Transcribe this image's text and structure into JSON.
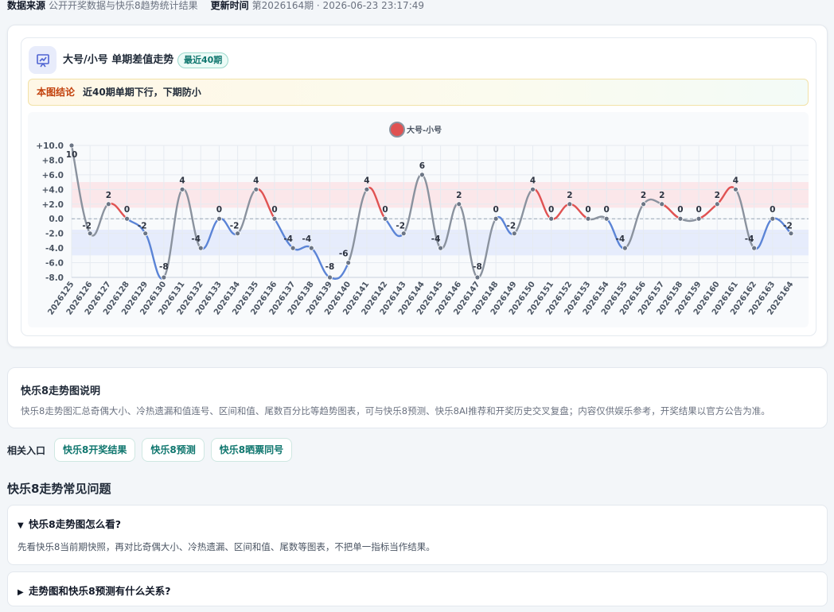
{
  "meta": {
    "source_label": "数据来源",
    "source_value": "公开开奖数据与快乐8趋势统计结果",
    "update_label": "更新时间",
    "update_value": "第2026164期 · 2026-06-23 23:17:49"
  },
  "card": {
    "icon": "presentation-chart-icon",
    "title": "大号/小号 单期差值走势",
    "badge": "最近40期",
    "conclusion_label": "本图结论",
    "conclusion_text": "近40期单期下行，下期防小"
  },
  "chart_data": {
    "type": "line",
    "legend": "大号-小号",
    "legend_position": "top-center",
    "x": [
      "2026125",
      "2026126",
      "2026127",
      "2026128",
      "2026129",
      "2026130",
      "2026131",
      "2026132",
      "2026133",
      "2026134",
      "2026135",
      "2026136",
      "2026137",
      "2026138",
      "2026139",
      "2026140",
      "2026141",
      "2026142",
      "2026143",
      "2026144",
      "2026145",
      "2026146",
      "2026147",
      "2026148",
      "2026149",
      "2026150",
      "2026151",
      "2026152",
      "2026153",
      "2026154",
      "2026155",
      "2026156",
      "2026157",
      "2026158",
      "2026159",
      "2026160",
      "2026161",
      "2026162",
      "2026163",
      "2026164"
    ],
    "series": [
      {
        "name": "大号-小号",
        "values": [
          10,
          -2,
          2,
          0,
          -2,
          -8,
          4,
          -4,
          0,
          -2,
          4,
          0,
          -4,
          -4,
          -8,
          -6,
          4,
          0,
          -2,
          6,
          -4,
          2,
          -8,
          0,
          -2,
          4,
          0,
          2,
          0,
          0,
          -4,
          2,
          2,
          0,
          0,
          2,
          4,
          -4,
          0,
          -2
        ]
      }
    ],
    "ylim": [
      -8,
      10
    ],
    "yticks": [
      "+10.0",
      "+8.0",
      "+6.0",
      "+4.0",
      "+2.0",
      "0.0",
      "-2.0",
      "-4.0",
      "-6.0",
      "-8.0"
    ],
    "bands": [
      {
        "from": 1.5,
        "to": 5
      },
      {
        "from": -5,
        "to": -1.5
      }
    ],
    "colors": {
      "up": "#e05252",
      "down": "#5b84d6",
      "flat": "#8a929e",
      "band_up": "#fbe3e6",
      "band_down": "#e3e9fb"
    },
    "grid": true
  },
  "explain": {
    "title": "快乐8走势图说明",
    "text": "快乐8走势图汇总奇偶大小、冷热遗漏和值连号、区间和值、尾数百分比等趋势图表，可与快乐8预测、快乐8AI推荐和开奖历史交叉复盘；内容仅供娱乐参考，开奖结果以官方公告为准。"
  },
  "related": {
    "label": "相关入口",
    "links": [
      "快乐8开奖结果",
      "快乐8预测",
      "快乐8晒票同号"
    ]
  },
  "faq": {
    "title": "快乐8走势常见问题",
    "items": [
      {
        "arrow": "▼",
        "question": "快乐8走势图怎么看?",
        "answer": "先看快乐8当前期快照，再对比奇偶大小、冷热遗漏、区间和值、尾数等图表，不把单一指标当作结果。"
      },
      {
        "arrow": "▶",
        "question": "走势图和快乐8预测有什么关系?"
      }
    ]
  }
}
